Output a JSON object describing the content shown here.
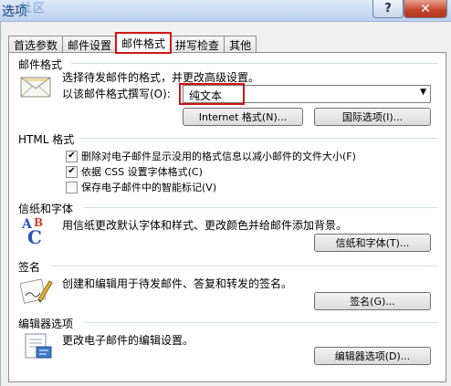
{
  "window": {
    "title": "选项",
    "watermark": "社区",
    "help_label": "?",
    "close_label": "✕"
  },
  "tabs": [
    {
      "label": "首选参数",
      "active": false
    },
    {
      "label": "邮件设置",
      "active": false
    },
    {
      "label": "邮件格式",
      "active": true
    },
    {
      "label": "拼写检查",
      "active": false
    },
    {
      "label": "其他",
      "active": false
    }
  ],
  "mail_format": {
    "group_title": "邮件格式",
    "description": "选择待发邮件的格式，并更改高级设置。",
    "compose_label": "以该邮件格式撰写(O):",
    "compose_value": "纯文本",
    "internet_format_button": "Internet 格式(N)...",
    "international_button": "国际选项(I)...",
    "icon": "envelope-icon"
  },
  "html_format": {
    "group_title": "HTML 格式",
    "options": [
      {
        "label": "删除对电子邮件显示没用的格式信息以减小邮件的文件大小(F)",
        "checked": true
      },
      {
        "label": "依据 CSS 设置字体格式(C)",
        "checked": true
      },
      {
        "label": "保存电子邮件中的智能标记(V)",
        "checked": false
      }
    ]
  },
  "stationery": {
    "group_title": "信纸和字体",
    "description": "用信纸更改默认字体和样式、更改颜色并给邮件添加背景。",
    "button": "信纸和字体(T)...",
    "icon": "abc-font-icon"
  },
  "signature": {
    "group_title": "签名",
    "description": "创建和编辑用于待发邮件、答复和转发的签名。",
    "button": "签名(G)...",
    "icon": "signature-pen-icon"
  },
  "editor": {
    "group_title": "编辑器选项",
    "description": "更改电子邮件的编辑设置。",
    "button": "编辑器选项(D)...",
    "icon": "editor-document-icon"
  },
  "colors": {
    "highlight": "#d21414",
    "title_blue": "#1a3a74"
  }
}
